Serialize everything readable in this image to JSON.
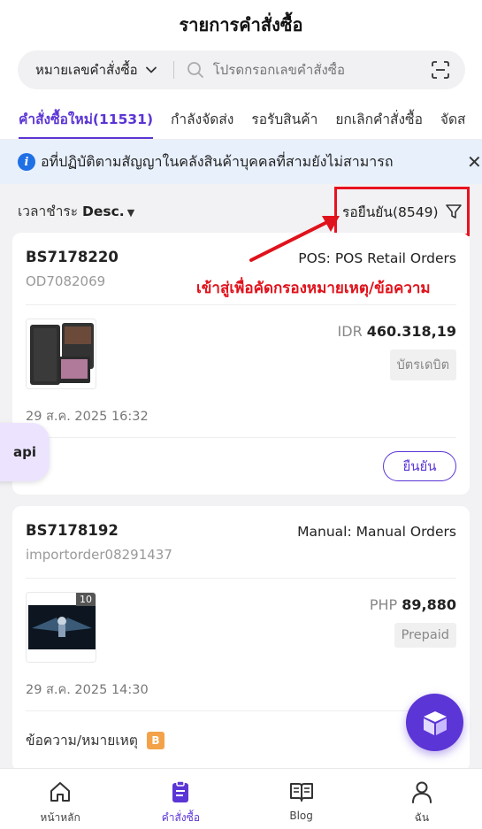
{
  "header": {
    "title": "รายการคำสั่งซื้อ"
  },
  "search": {
    "type_select": "หมายเลขคำสั่งซื้อ",
    "placeholder": "โปรดกรอกเลขคำสั่งซื้อ",
    "icons": [
      "chevron-down-icon",
      "search-icon",
      "scan-icon"
    ]
  },
  "tabs": [
    {
      "label": "คำสั่งซื้อใหม่(11531)",
      "active": true
    },
    {
      "label": "กำลังจัดส่ง",
      "active": false
    },
    {
      "label": "รอรับสินค้า",
      "active": false
    },
    {
      "label": "ยกเลิกคำสั่งซื้อ",
      "active": false
    },
    {
      "label": "จัดส",
      "active": false
    }
  ],
  "notice": {
    "text": "อที่ปฏิบัติตามสัญญาในคลังสินค้าบุคคลที่สามยังไม่สามารถ",
    "close": "✕"
  },
  "sort": {
    "label": "เวลาชำระ",
    "order": "Desc.",
    "caret": "▼"
  },
  "filter": {
    "label": "รอยืนยัน(8549)"
  },
  "annotation": {
    "text": "เข้าสู่เพื่อคัดกรองหมายเหตุ/ข้อความ"
  },
  "orders": [
    {
      "order_no": "BS7178220",
      "sub_id": "OD7082069",
      "channel": "POS: POS Retail Orders",
      "currency": "IDR",
      "amount": "460.318,19",
      "payment": "บัตรเดบิต",
      "date": "29 ส.ค. 2025 16:32",
      "action": "ยืนยัน"
    },
    {
      "order_no": "BS7178192",
      "sub_id": "importorder08291437",
      "channel": "Manual: Manual Orders",
      "currency": "PHP",
      "amount": "89,880",
      "payment": "Prepaid",
      "qty_badge": "10",
      "date": "29 ส.ค. 2025 14:30",
      "note_label": "ข้อความ/หมายเหตุ",
      "note_badge": "B"
    }
  ],
  "floating": {
    "api_label": "api"
  },
  "bottom_nav": [
    {
      "label": "หน้าหลัก",
      "icon": "home-icon",
      "active": false
    },
    {
      "label": "คำสั่งซื้อ",
      "icon": "clipboard-icon",
      "active": true
    },
    {
      "label": "Blog",
      "icon": "book-icon",
      "active": false
    },
    {
      "label": "ฉัน",
      "icon": "user-icon",
      "active": false
    }
  ],
  "colors": {
    "accent": "#5b35d5",
    "annotation_red": "#e0121b",
    "info_blue": "#1f6fe5",
    "badge_orange": "#f3a24a"
  }
}
